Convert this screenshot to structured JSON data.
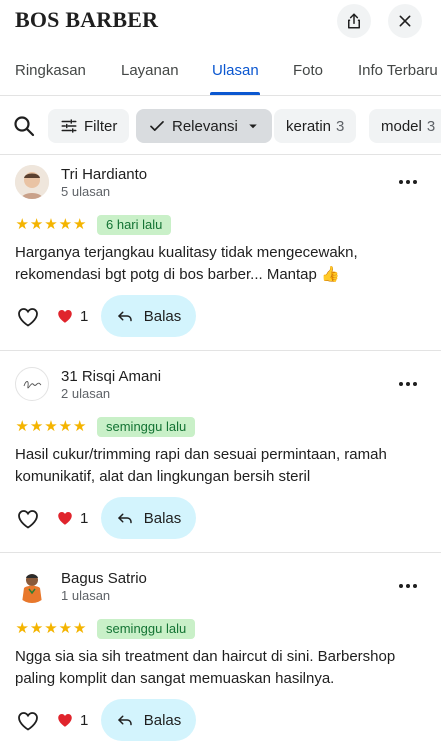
{
  "header": {
    "title": "BOS BARBER",
    "share_icon": "share-icon",
    "close_icon": "close-icon"
  },
  "tabs": [
    {
      "label": "Ringkasan",
      "active": false
    },
    {
      "label": "Layanan",
      "active": false
    },
    {
      "label": "Ulasan",
      "active": true
    },
    {
      "label": "Foto",
      "active": false
    },
    {
      "label": "Info Terbaru",
      "active": false
    }
  ],
  "filters": {
    "search_icon": "search-icon",
    "filter_label": "Filter",
    "sort_label": "Relevansi",
    "topics": [
      {
        "label": "keratin",
        "count": "3"
      },
      {
        "label": "model",
        "count": "3"
      }
    ]
  },
  "reviews": [
    {
      "author": "Tri Hardianto",
      "meta": "5 ulasan",
      "rating": 5,
      "time": "6 hari lalu",
      "text": "Harganya terjangkau kualitasy tidak mengecewakn, rekomendasi bgt potg di bos barber... Mantap 👍",
      "reaction_count": "1",
      "reply_label": "Balas"
    },
    {
      "author": "31 Risqi Amani",
      "meta": "2 ulasan",
      "rating": 5,
      "time": "seminggu lalu",
      "text": "Hasil cukur/trimming rapi dan sesuai permintaan, ramah komunikatif, alat dan lingkungan bersih steril",
      "reaction_count": "1",
      "reply_label": "Balas"
    },
    {
      "author": "Bagus Satrio",
      "meta": "1 ulasan",
      "rating": 5,
      "time": "seminggu lalu",
      "text": "Ngga sia sia sih treatment dan haircut di sini. Barbershop paling komplit dan sangat memuaskan hasilnya.",
      "reaction_count": "1",
      "reply_label": "Balas"
    }
  ],
  "colors": {
    "accent": "#0b57d0",
    "star": "#f4b400",
    "badge_bg": "#c9f0c8",
    "badge_text": "#137333",
    "reply_bg": "#d3f4fd"
  }
}
